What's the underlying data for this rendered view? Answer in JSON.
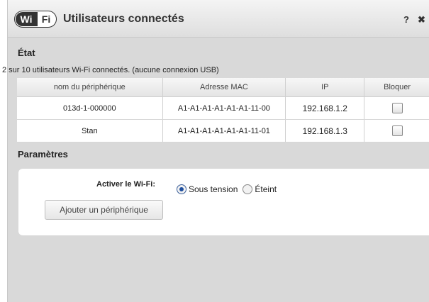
{
  "header": {
    "logo_text": "Wi",
    "logo_text2": "Fi",
    "title": "Utilisateurs connectés",
    "help_label": "?",
    "close_label": "✖"
  },
  "status": {
    "section_title": "État",
    "summary": "2 sur 10 utilisateurs Wi-Fi connectés. (aucune connexion USB)"
  },
  "devices_table": {
    "columns": [
      "nom du périphérique",
      "Adresse MAC",
      "IP",
      "Bloquer"
    ],
    "rows": [
      {
        "name": "013d-1-000000",
        "mac": "A1-A1-A1-A1-A1-A1-11-00",
        "ip": "192.168.1.2",
        "blocked": false
      },
      {
        "name": "Stan",
        "mac": "A1-A1-A1-A1-A1-A1-11-01",
        "ip": "192.168.1.3",
        "blocked": false
      }
    ]
  },
  "settings": {
    "section_title": "Paramètres",
    "wifi_label": "Activer le Wi-Fi:",
    "wifi_on_label": "Sous tension",
    "wifi_off_label": "Éteint",
    "wifi_selected": "on",
    "add_device_label": "Ajouter un périphérique"
  }
}
